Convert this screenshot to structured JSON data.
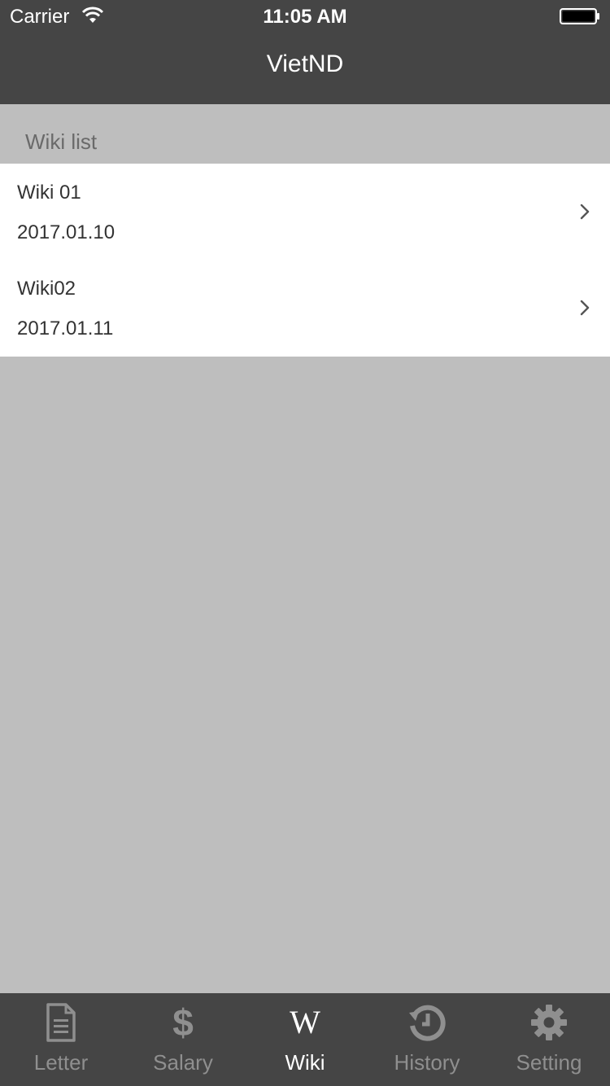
{
  "status_bar": {
    "carrier": "Carrier",
    "time": "11:05 AM"
  },
  "nav": {
    "title": "VietND"
  },
  "section": {
    "title": "Wiki list"
  },
  "wiki_items": [
    {
      "title": "Wiki 01",
      "date": "2017.01.10"
    },
    {
      "title": "Wiki02",
      "date": "2017.01.11"
    }
  ],
  "tabs": [
    {
      "label": "Letter",
      "icon": "document-icon",
      "active": false
    },
    {
      "label": "Salary",
      "icon": "dollar-icon",
      "active": false
    },
    {
      "label": "Wiki",
      "icon": "wikipedia-w-icon",
      "active": true
    },
    {
      "label": "History",
      "icon": "history-icon",
      "active": false
    },
    {
      "label": "Setting",
      "icon": "gear-icon",
      "active": false
    }
  ],
  "colors": {
    "bar": "#454545",
    "background": "#bebebe",
    "tab_active": "#ffffff",
    "tab_inactive": "#8f8f8f"
  }
}
